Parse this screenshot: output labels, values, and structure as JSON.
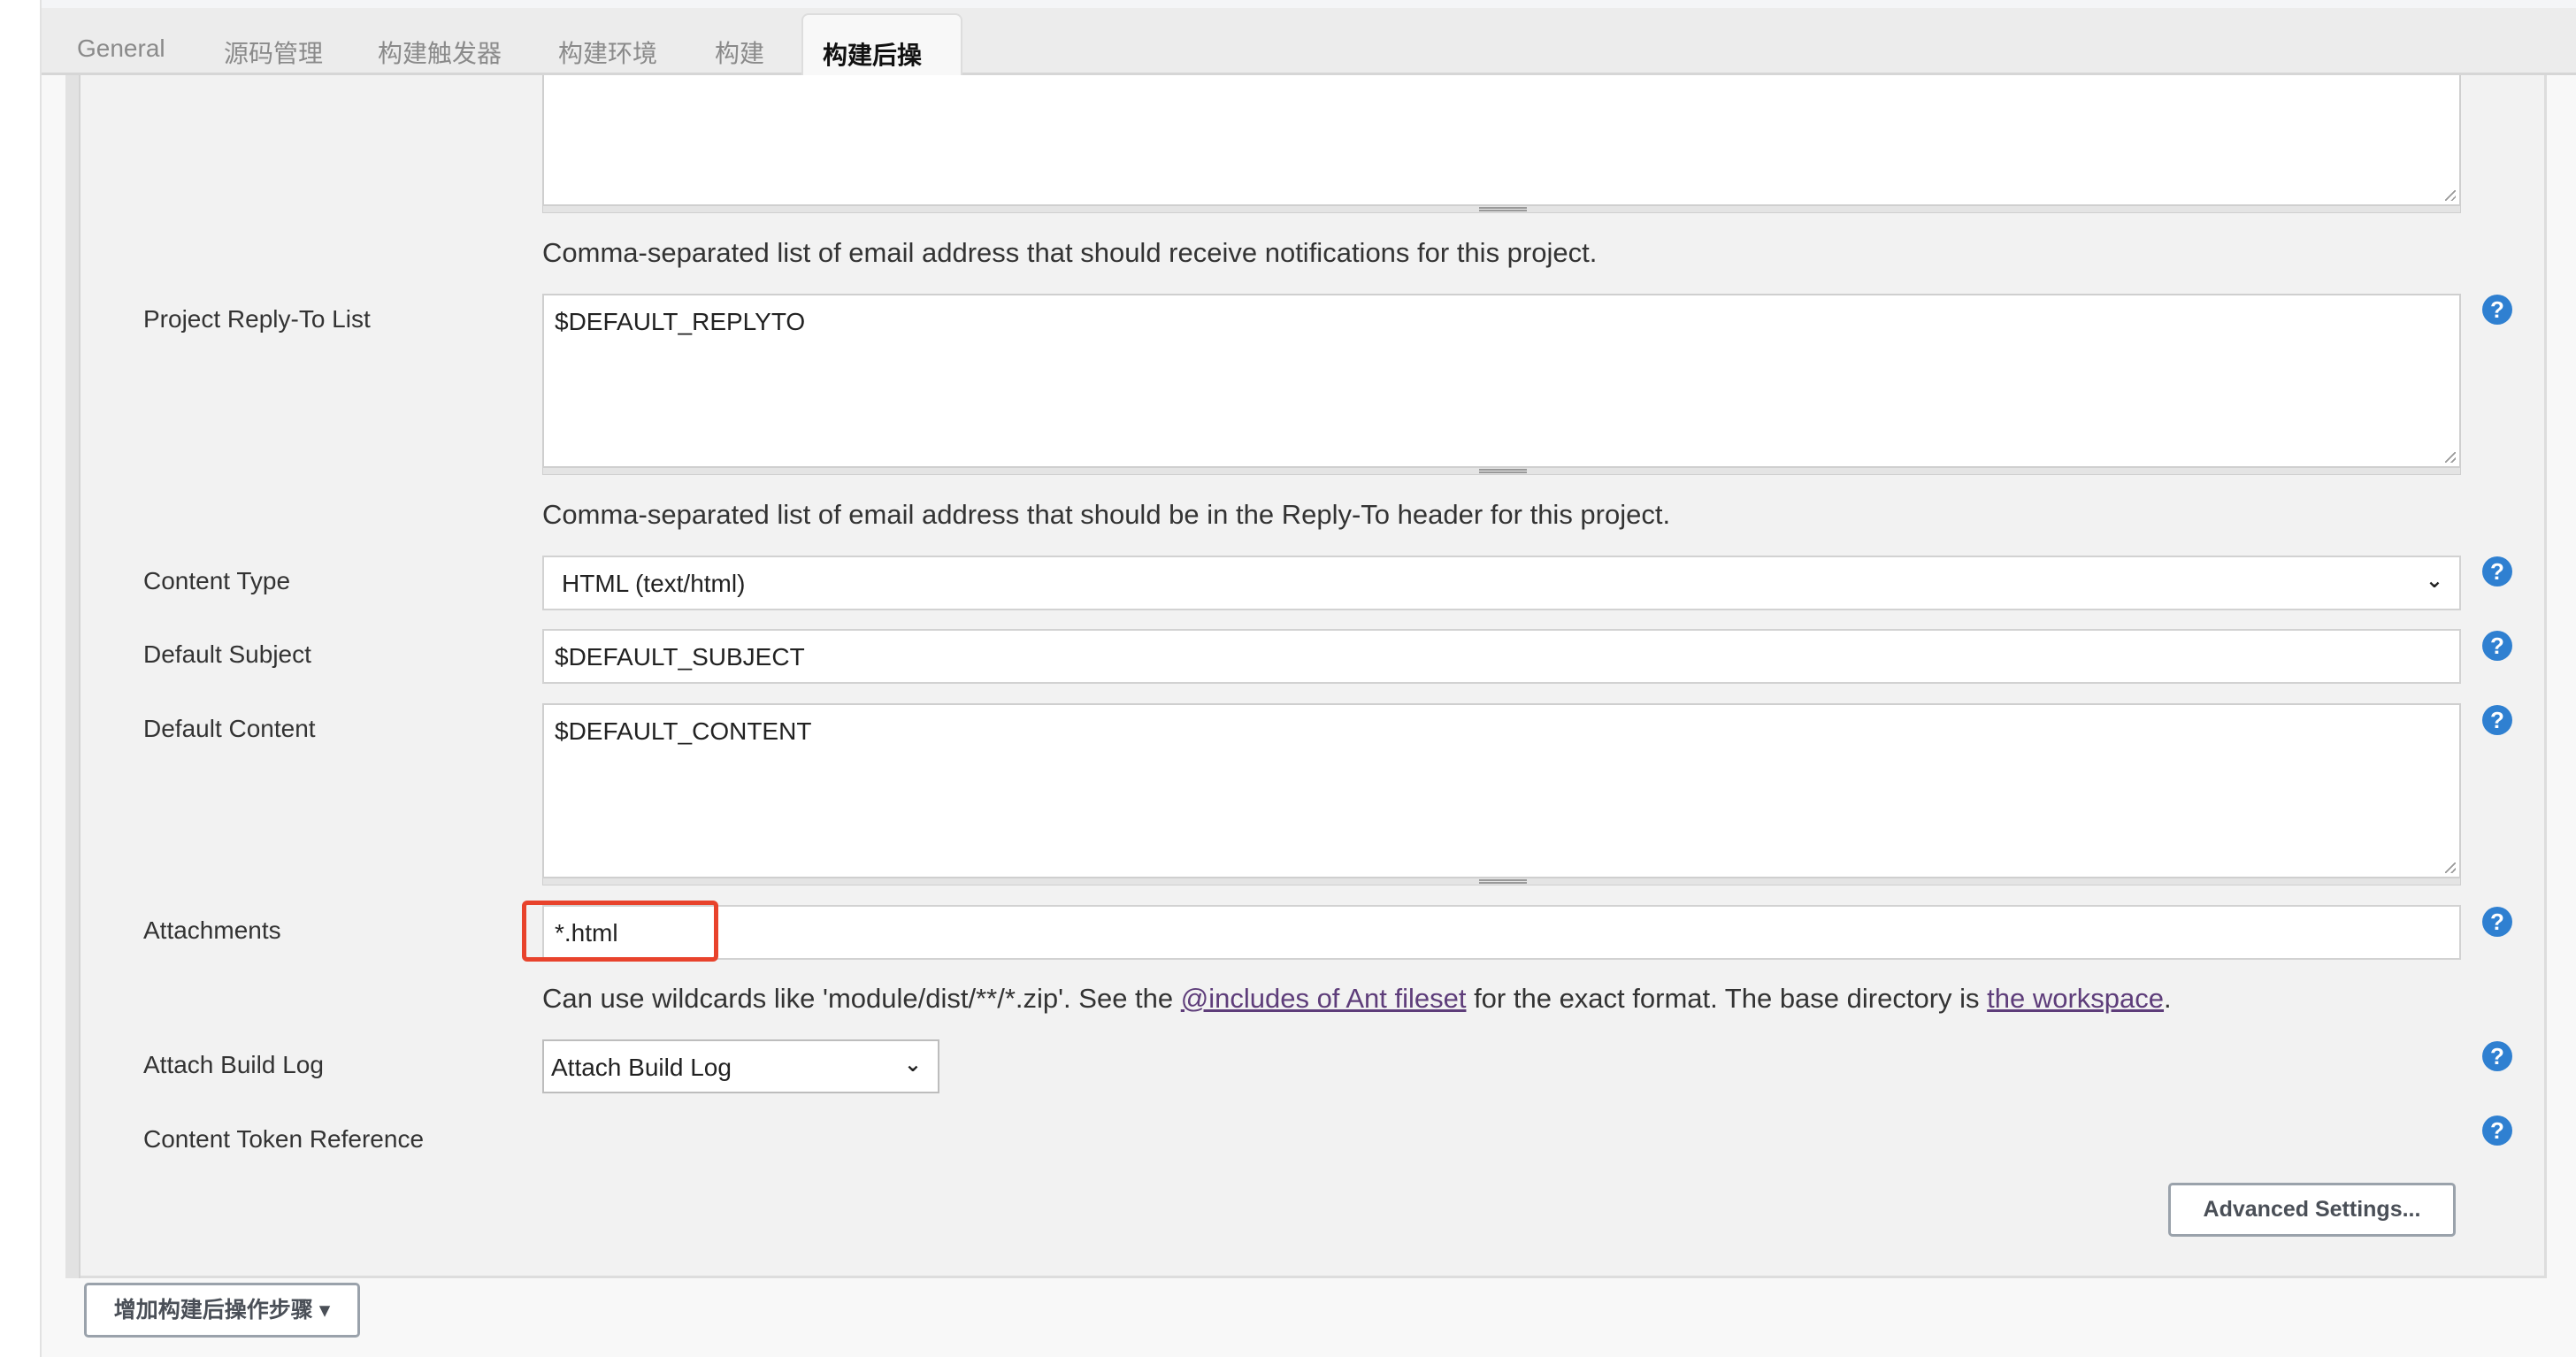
{
  "tabs": [
    {
      "label": "General"
    },
    {
      "label": "源码管理"
    },
    {
      "label": "构建触发器"
    },
    {
      "label": "构建环境"
    },
    {
      "label": "构建"
    },
    {
      "label": "构建后操作",
      "active": true
    }
  ],
  "fields": {
    "recipients_help": "Comma-separated list of email address that should receive notifications for this project.",
    "reply_to": {
      "label": "Project Reply-To List",
      "value": "$DEFAULT_REPLYTO",
      "help": "Comma-separated list of email address that should be in the Reply-To header for this project."
    },
    "content_type": {
      "label": "Content Type",
      "value": "HTML (text/html)"
    },
    "default_subject": {
      "label": "Default Subject",
      "value": "$DEFAULT_SUBJECT"
    },
    "default_content": {
      "label": "Default Content",
      "value": "$DEFAULT_CONTENT"
    },
    "attachments": {
      "label": "Attachments",
      "value": "*.html",
      "help_pre": "Can use wildcards like 'module/dist/**/*.zip'. See the ",
      "help_link1": "@includes of Ant fileset",
      "help_mid": " for the exact format. The base directory is ",
      "help_link2": "the workspace",
      "help_post": "."
    },
    "attach_build_log": {
      "label": "Attach Build Log",
      "value": "Attach Build Log"
    },
    "content_token_reference": {
      "label": "Content Token Reference"
    }
  },
  "buttons": {
    "advanced": "Advanced Settings...",
    "add_post_build": "增加构建后操作步骤"
  },
  "icons": {
    "help": "?",
    "dropdown": "▾",
    "chevron": "⌄"
  },
  "colors": {
    "help_icon": "#2f80d1",
    "highlight": "#e8432c",
    "link": "#5e3d7a"
  }
}
